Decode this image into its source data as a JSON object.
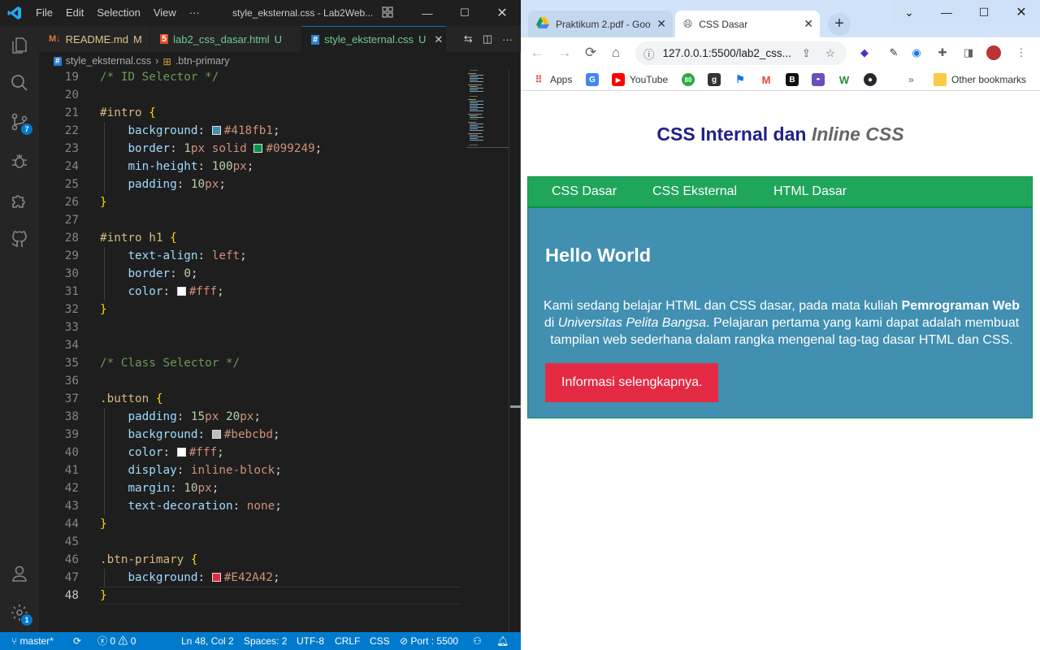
{
  "vscode": {
    "menu": [
      "File",
      "Edit",
      "Selection",
      "View",
      "···"
    ],
    "window_title": "style_eksternal.css - Lab2Web...",
    "tabs": [
      {
        "icon": "M↓",
        "label": "README.md",
        "status": "M",
        "color": "#e2c08d",
        "active": false
      },
      {
        "icon": "5",
        "label": "lab2_css_dasar.html",
        "status": "U",
        "color": "#73c991",
        "active": false
      },
      {
        "icon": "#",
        "label": "style_eksternal.css",
        "status": "U",
        "color": "#73c991",
        "active": true
      }
    ],
    "breadcrumb": {
      "file": "style_eksternal.css",
      "symbol": ".btn-primary"
    },
    "activity_badges": {
      "source_control": "7",
      "accounts_settings": "1"
    },
    "code_lines": [
      {
        "num": "19",
        "text": "/* ID Selector */"
      },
      {
        "num": "20",
        "text": ""
      },
      {
        "num": "21",
        "text": "#intro {"
      },
      {
        "num": "22",
        "text": "background: #418fb1;"
      },
      {
        "num": "23",
        "text": "border: 1px solid #099249;"
      },
      {
        "num": "24",
        "text": "min-height: 100px;"
      },
      {
        "num": "25",
        "text": "padding: 10px;"
      },
      {
        "num": "26",
        "text": "}"
      },
      {
        "num": "27",
        "text": ""
      },
      {
        "num": "28",
        "text": "#intro h1 {"
      },
      {
        "num": "29",
        "text": "text-align: left;"
      },
      {
        "num": "30",
        "text": "border: 0;"
      },
      {
        "num": "31",
        "text": "color: #fff;"
      },
      {
        "num": "32",
        "text": "}"
      },
      {
        "num": "33",
        "text": ""
      },
      {
        "num": "34",
        "text": ""
      },
      {
        "num": "35",
        "text": "/* Class Selector */"
      },
      {
        "num": "36",
        "text": ""
      },
      {
        "num": "37",
        "text": ".button {"
      },
      {
        "num": "38",
        "text": "padding: 15px 20px;"
      },
      {
        "num": "39",
        "text": "background: #bebcbd;"
      },
      {
        "num": "40",
        "text": "color: #fff;"
      },
      {
        "num": "41",
        "text": "display: inline-block;"
      },
      {
        "num": "42",
        "text": "margin: 10px;"
      },
      {
        "num": "43",
        "text": "text-decoration: none;"
      },
      {
        "num": "44",
        "text": "}"
      },
      {
        "num": "45",
        "text": ""
      },
      {
        "num": "46",
        "text": ".btn-primary {"
      },
      {
        "num": "47",
        "text": "background: #E42A42;"
      },
      {
        "num": "48",
        "text": "}"
      }
    ],
    "current_line": "48",
    "status": {
      "branch": "master*",
      "problems": "0",
      "warnings": "0",
      "position": "Ln 48, Col 2",
      "spaces": "Spaces: 2",
      "encoding": "UTF-8",
      "eol": "CRLF",
      "language": "CSS",
      "port": "Port : 5500"
    }
  },
  "chrome": {
    "tabs": [
      {
        "label": "Praktikum 2.pdf - Goo",
        "active": false
      },
      {
        "label": "CSS Dasar",
        "active": true
      }
    ],
    "url": "127.0.0.1:5500/lab2_css...",
    "bookmarks": [
      "Apps",
      "YouTube",
      "Other bookmarks"
    ],
    "page": {
      "title_plain": "CSS Internal dan ",
      "title_italic": "Inline CSS",
      "nav": [
        "CSS Dasar",
        "CSS Eksternal",
        "HTML Dasar"
      ],
      "heading": "Hello World",
      "para_1": "Kami sedang belajar HTML dan CSS dasar, pada mata kuliah ",
      "para_bold": "Pemrograman Web",
      "para_2": " di ",
      "para_italic": "Universitas Pelita Bangsa",
      "para_3": ". Pelajaran pertama yang kami dapat adalah membuat tampilan web sederhana dalam rangka mengenal tag-tag dasar HTML dan CSS.",
      "button": "Informasi selengkapnya."
    }
  },
  "colors": {
    "accent": "#007acc",
    "intro_bg": "#418fb1",
    "intro_border": "#099249",
    "nav_bg": "#1fa65b",
    "btn_primary": "#E42A42",
    "button_grey": "#bebcbd"
  }
}
